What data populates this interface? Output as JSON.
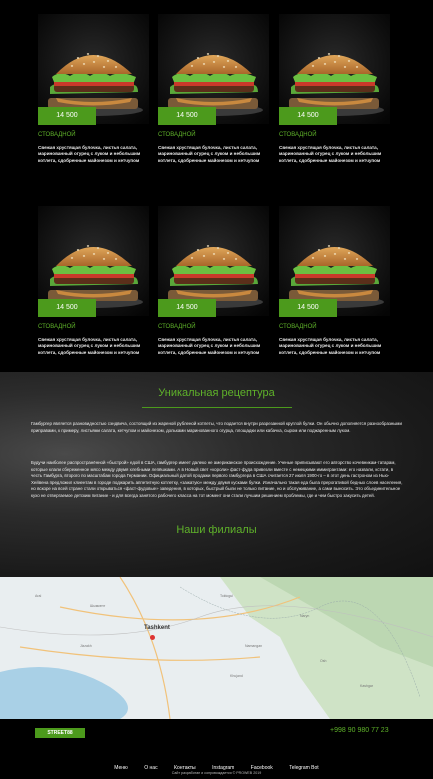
{
  "products": [
    {
      "price": "14 500",
      "category": "СТОВАДНОЙ",
      "description": "Свежая хрустящая булочка, листья салата, маринованный огурец с луком и небольшим котлета, сдобренные майонезом и кетчупом"
    },
    {
      "price": "14 500",
      "category": "СТОВАДНОЙ",
      "description": "Свежая хрустящая булочка, листья салата, маринованный огурец с луком и небольшим котлета, сдобренные майонезом и кетчупом"
    },
    {
      "price": "14 500",
      "category": "СТОВАДНОЙ",
      "description": "Свежая хрустящая булочка, листья салата, маринованный огурец с луком и небольшим котлета, сдобренные майонезом и кетчупом"
    },
    {
      "price": "14 500",
      "category": "СТОВАДНОЙ",
      "description": "Свежая хрустящая булочка, листья салата, маринованный огурец с луком и небольшим котлета, сдобренные майонезом и кетчупом"
    },
    {
      "price": "14 500",
      "category": "СТОВАДНОЙ",
      "description": "Свежая хрустящая булочка, листья салата, маринованный огурец с луком и небольшим котлета, сдобренные майонезом и кетчупом"
    },
    {
      "price": "14 500",
      "category": "СТОВАДНОЙ",
      "description": "Свежая хрустящая булочка, листья салата, маринованный огурец с луком и небольшим котлета, сдобренные майонезом и кетчупом"
    }
  ],
  "recipe": {
    "title": "Уникальная рецептура",
    "paragraph1": "Гамбургер является разновидностью сэндвича, состоящий из жареной рубленой котлеты, что подается внутри разрезанной круглой булки. Он обычно дополняется разнообразными приправами, к примеру, листьями салата, кетчупом и майонезом, дольками маринованного огурца, площадки или кабачка, сыром или поджаренным луком.",
    "paragraph2": "Будучи наиболее распространённой «быстрой» едой в США, гамбургер имеет далеко не американское происхождение. Ученые приписывают его авторство кочевникам-татарам, которые клали сбереженное мясо между двумя хлебными лепёшками. А в Новый свет «короли» фаст-фуда привезли вместе с немецкими иммигрантами: его назвали, кстати, в честь Гамбурга, второго по масштабам города Германии. Официальный датой продажи первого гамбургера в США считается 27 июля 1900-го – в этот день гастроном из Нью-Хейвена предложил клиентам в городе поджарить аппетитную котлетку, «зажатую» между двумя кусками булки. Изначально такая еда была прерогативой бедных слоев населения, но вскоре на всей стране стали открываться «фаст-фудовые» заведения, в которых, быстрый были не только питание, но и обслуживание, а сами выносить. Это объединительное кухо не отвергаемое детским питание - и для всегда занятого рабочего класса на тот момент они стали лучшим решением проблемы, где и чем быстро закусить детей.",
    "branches_title": "Наши филиалы"
  },
  "map": {
    "city_label": "Tashkent"
  },
  "footer": {
    "logo": "STREET88",
    "phone": "+998 90 980 77 23",
    "nav": [
      "Меню",
      "О нас",
      "Контакты",
      "Instagram",
      "Facebook",
      "Telegram Bot"
    ],
    "copyright": "Сайт разработан и сопровождается © PROWEB 2019"
  },
  "colors": {
    "accent": "#4c9a1c",
    "text_accent": "#5fb22a",
    "background": "#000000"
  }
}
